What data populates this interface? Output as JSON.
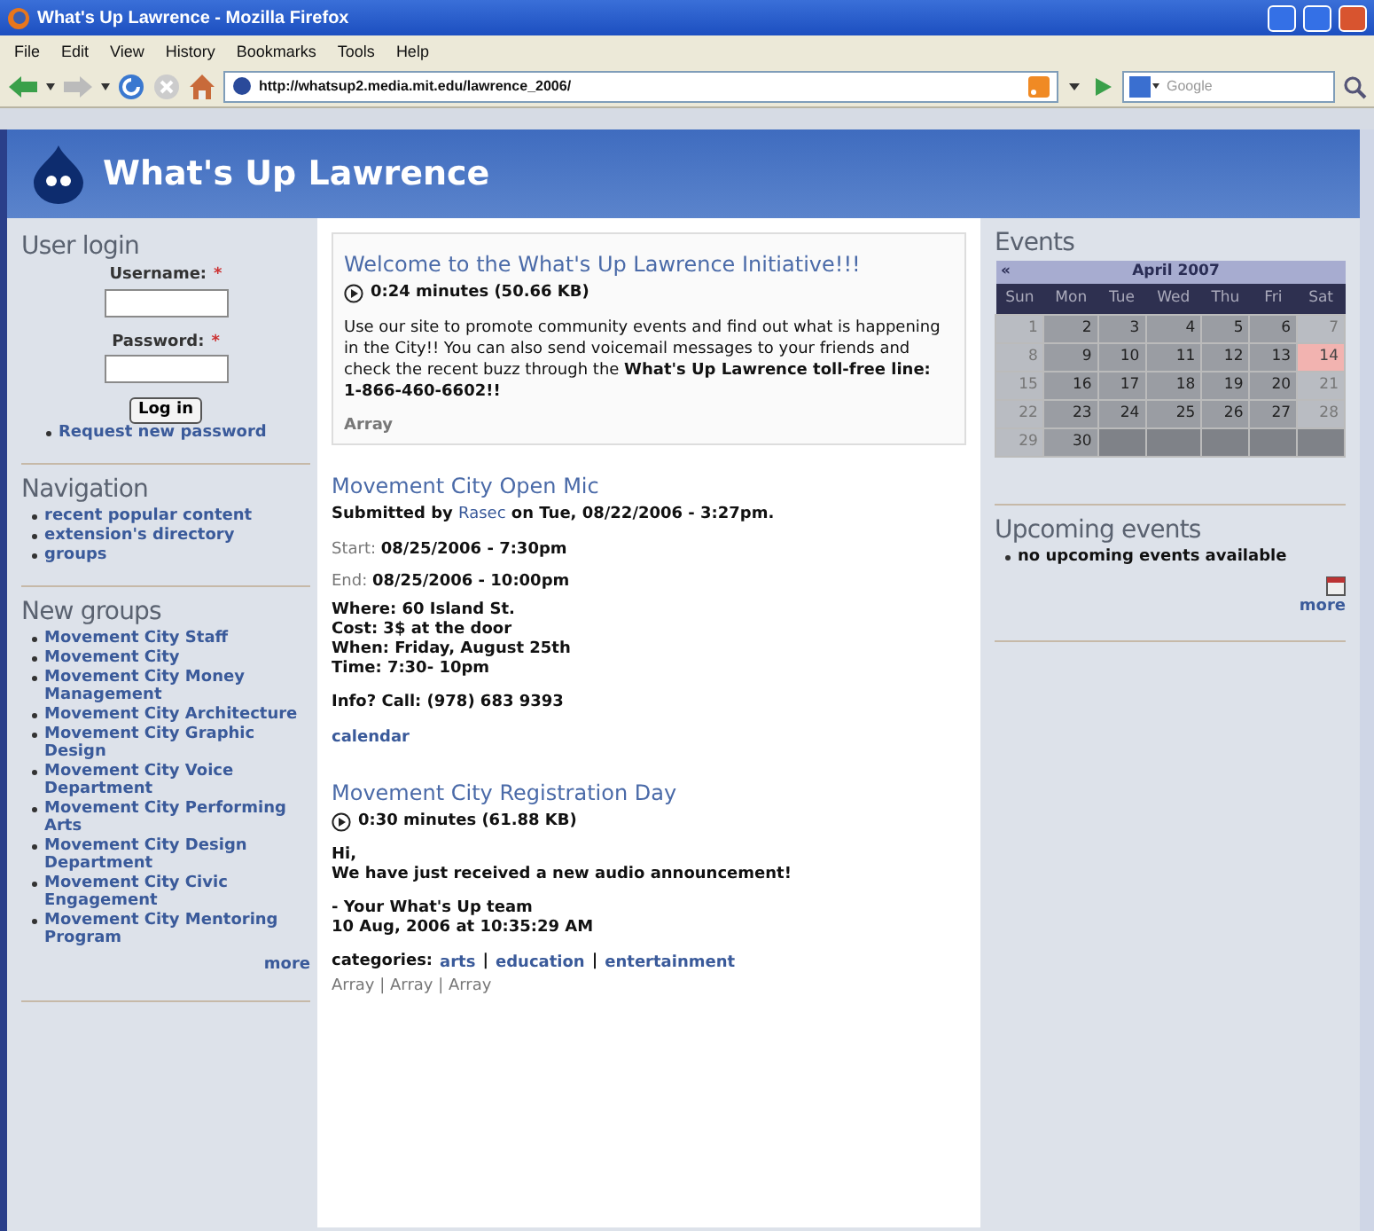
{
  "window": {
    "title": "What's Up Lawrence - Mozilla Firefox"
  },
  "menu": [
    "File",
    "Edit",
    "View",
    "History",
    "Bookmarks",
    "Tools",
    "Help"
  ],
  "toolbar": {
    "url": "http://whatsup2.media.mit.edu/lawrence_2006/",
    "search_placeholder": "Google"
  },
  "site": {
    "title": "What's Up Lawrence"
  },
  "login": {
    "title": "User login",
    "fields": [
      {
        "label": "Username:",
        "required": "*"
      },
      {
        "label": "Password:",
        "required": "*"
      }
    ],
    "button": "Log in",
    "links": [
      "Request new password"
    ]
  },
  "navigation": {
    "title": "Navigation",
    "items": [
      "recent popular content",
      "extension's directory",
      "groups"
    ]
  },
  "new_groups": {
    "title": "New groups",
    "items": [
      "Movement City Staff",
      "Movement City",
      "Movement City Money Management",
      "Movement City Architecture",
      "Movement City Graphic Design",
      "Movement City Voice Department",
      "Movement City Performing Arts",
      "Movement City Design Department",
      "Movement City Civic Engagement",
      "Movement City Mentoring Program"
    ],
    "more": "more"
  },
  "welcome": {
    "title": "Welcome to the What's Up Lawrence Initiative!!!",
    "audio": "0:24 minutes (50.66 KB)",
    "body": "Use our site to promote community events and find out what is happening in the City!! You can also send voicemail messages to your friends and check the recent buzz through the **What's Up Lawrence toll-free line: 1-866-460-6602!!**",
    "footer": "Array"
  },
  "event_post": {
    "title": "Movement City Open Mic",
    "submitted_prefix": "Submitted by",
    "author": "Rasec",
    "submitted_suffix": "on Tue, 08/22/2006 - 3:27pm.",
    "dates": [
      "Start: **08/25/2006 - 7:30pm**",
      "End: **08/25/2006 - 10:00pm**"
    ],
    "details": [
      "Where: 60 Island St.",
      "Cost: 3$ at the door",
      "When: Friday, August 25th",
      "Time: 7:30- 10pm"
    ],
    "info": "Info? Call: (978) 683 9393",
    "link": "calendar"
  },
  "audio_post": {
    "title": "Movement City Registration Day",
    "audio": "0:30 minutes (61.88 KB)",
    "lines": [
      "Hi,",
      "We have just received a new audio announcement!"
    ],
    "signature": [
      "- Your What's Up team",
      "10 Aug, 2006 at 10:35:29 AM"
    ],
    "categories_label": "categories:",
    "categories": [
      "arts",
      "education",
      "entertainment"
    ],
    "separator": "|",
    "footer": "Array | Array | Array"
  },
  "events": {
    "title": "Events",
    "calendar": {
      "prev": "«",
      "month": "April 2007",
      "weekdays": [
        "Sun",
        "Mon",
        "Tue",
        "Wed",
        "Thu",
        "Fri",
        "Sat"
      ],
      "weeks": [
        [
          {
            "day": "1",
            "today": false
          },
          {
            "day": "2",
            "today": false
          },
          {
            "day": "3",
            "today": false
          },
          {
            "day": "4",
            "today": false
          },
          {
            "day": "5",
            "today": false
          },
          {
            "day": "6",
            "today": false
          },
          {
            "day": "7",
            "today": false
          }
        ],
        [
          {
            "day": "8",
            "today": false
          },
          {
            "day": "9",
            "today": false
          },
          {
            "day": "10",
            "today": false
          },
          {
            "day": "11",
            "today": false
          },
          {
            "day": "12",
            "today": false
          },
          {
            "day": "13",
            "today": false
          },
          {
            "day": "14",
            "today": true
          }
        ],
        [
          {
            "day": "15",
            "today": false
          },
          {
            "day": "16",
            "today": false
          },
          {
            "day": "17",
            "today": false
          },
          {
            "day": "18",
            "today": false
          },
          {
            "day": "19",
            "today": false
          },
          {
            "day": "20",
            "today": false
          },
          {
            "day": "21",
            "today": false
          }
        ],
        [
          {
            "day": "22",
            "today": false
          },
          {
            "day": "23",
            "today": false
          },
          {
            "day": "24",
            "today": false
          },
          {
            "day": "25",
            "today": false
          },
          {
            "day": "26",
            "today": false
          },
          {
            "day": "27",
            "today": false
          },
          {
            "day": "28",
            "today": false
          }
        ],
        [
          {
            "day": "29",
            "today": false
          },
          {
            "day": "30",
            "today": false
          }
        ]
      ]
    }
  },
  "upcoming": {
    "title": "Upcoming events",
    "items": [
      "no upcoming events available"
    ],
    "more": "more"
  }
}
